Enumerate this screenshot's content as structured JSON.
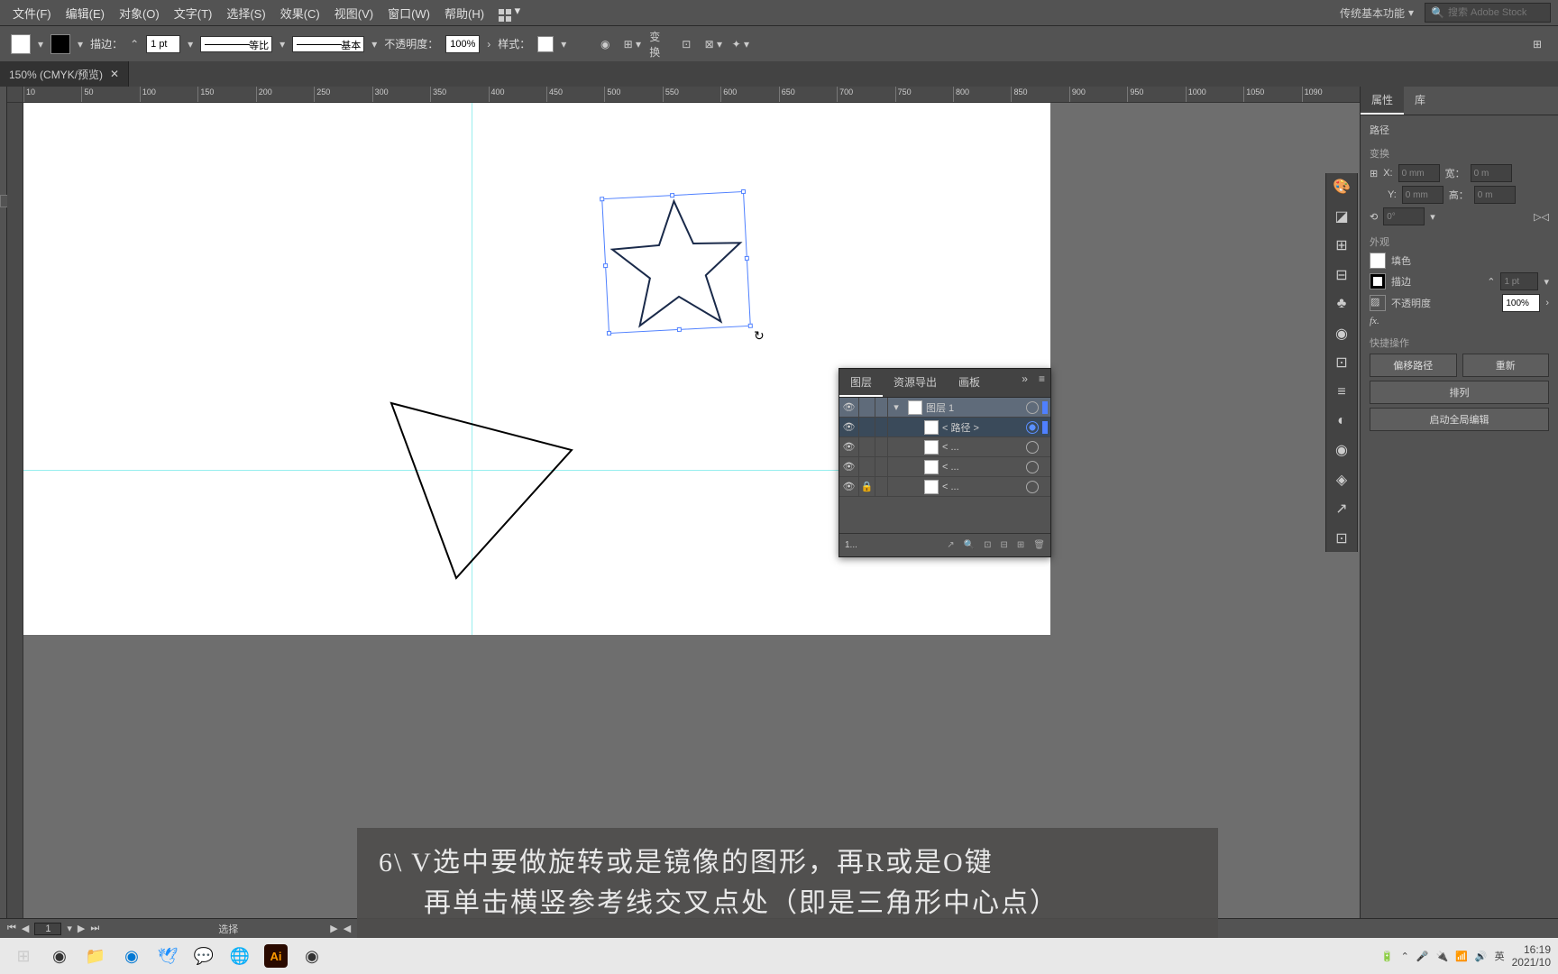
{
  "menu": {
    "file": "文件(F)",
    "edit": "编辑(E)",
    "object": "对象(O)",
    "type": "文字(T)",
    "select": "选择(S)",
    "effect": "效果(C)",
    "view": "视图(V)",
    "window": "窗口(W)",
    "help": "帮助(H)"
  },
  "workspace_sel": "传统基本功能",
  "search_placeholder": "搜索 Adobe Stock",
  "options": {
    "stroke_label": "描边：",
    "stroke_w": "1 pt",
    "ratio": "等比",
    "basic": "基本",
    "opacity_label": "不透明度：",
    "opacity": "100%",
    "style_label": "样式：",
    "transform": "变换"
  },
  "doc_tab": "150% (CMYK/预览)",
  "ruler_marks": [
    "10",
    "50",
    "100",
    "150",
    "200",
    "250",
    "300",
    "350",
    "400",
    "450",
    "500",
    "550",
    "600",
    "650",
    "700",
    "750",
    "800",
    "850",
    "900",
    "950",
    "1000",
    "1050",
    "1090"
  ],
  "props": {
    "tab_props": "属性",
    "tab_libs": "库",
    "sel_type": "路径",
    "transform": "变换",
    "x_lbl": "X:",
    "x": "0 mm",
    "y_lbl": "Y:",
    "y": "0 mm",
    "w_lbl": "宽：",
    "w": "0 m",
    "h_lbl": "高：",
    "h": "0 m",
    "rot": "0°",
    "appearance": "外观",
    "fill": "填色",
    "stroke": "描边",
    "stroke_v": "1 pt",
    "opacity": "不透明度",
    "opacity_v": "100%",
    "fx": "fx.",
    "quick": "快捷操作",
    "offset": "偏移路径",
    "recolor": "重新",
    "arrange": "排列",
    "global": "启动全局编辑"
  },
  "layers": {
    "tab_layers": "图层",
    "tab_assets": "资源导出",
    "tab_artboards": "画板",
    "layer1": "图层 1",
    "path": "< 路径 >",
    "clip1": "< ...",
    "clip2": "< ...",
    "clip3": "< ...",
    "count": "1..."
  },
  "status": {
    "page": "1",
    "mode": "选择"
  },
  "caption_l1": "6\\ V选中要做旋转或是镜像的图形，再R或是O键",
  "caption_l2": "再单击横竖参考线交叉点处（即是三角形中心点）",
  "taskbar": {
    "time": "16:19",
    "date": "2021/10",
    "ime": "英"
  }
}
